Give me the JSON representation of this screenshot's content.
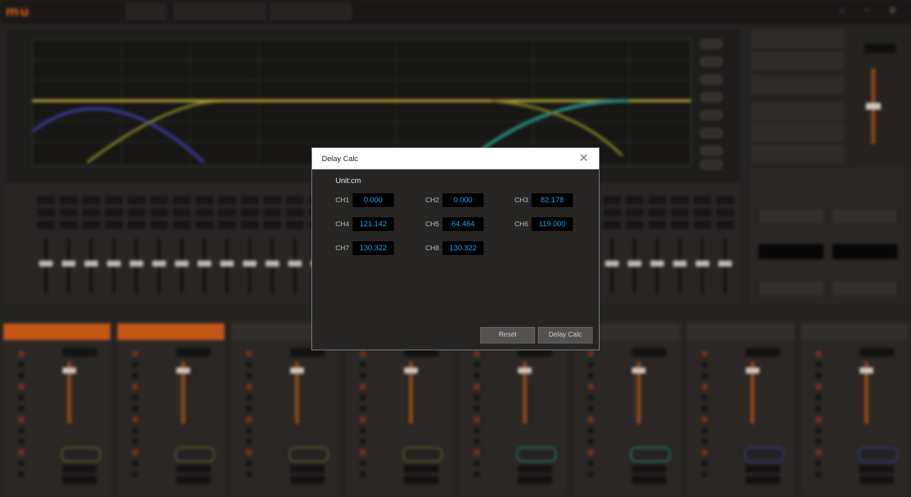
{
  "dialog": {
    "title": "Delay Calc",
    "close_glyph": "✕",
    "unit_label": "Unit:cm",
    "channels": [
      {
        "label": "CH1",
        "value": "0.000"
      },
      {
        "label": "CH2",
        "value": "0.000"
      },
      {
        "label": "CH3",
        "value": "82.178"
      },
      {
        "label": "CH4",
        "value": "121.142"
      },
      {
        "label": "CH5",
        "value": "64.464"
      },
      {
        "label": "CH6",
        "value": "119.000"
      },
      {
        "label": "CH7",
        "value": "130.322"
      },
      {
        "label": "CH8",
        "value": "130.322"
      }
    ],
    "reset_label": "Reset",
    "calc_label": "Delay Calc"
  },
  "colors": {
    "accent": "#e0621a",
    "value_text": "#1ea2f2",
    "dialog_bg": "#262524",
    "titlebar_bg": "#ffffff"
  },
  "icons": [
    "close-icon",
    "search-icon",
    "minimize-icon",
    "settings-icon"
  ]
}
